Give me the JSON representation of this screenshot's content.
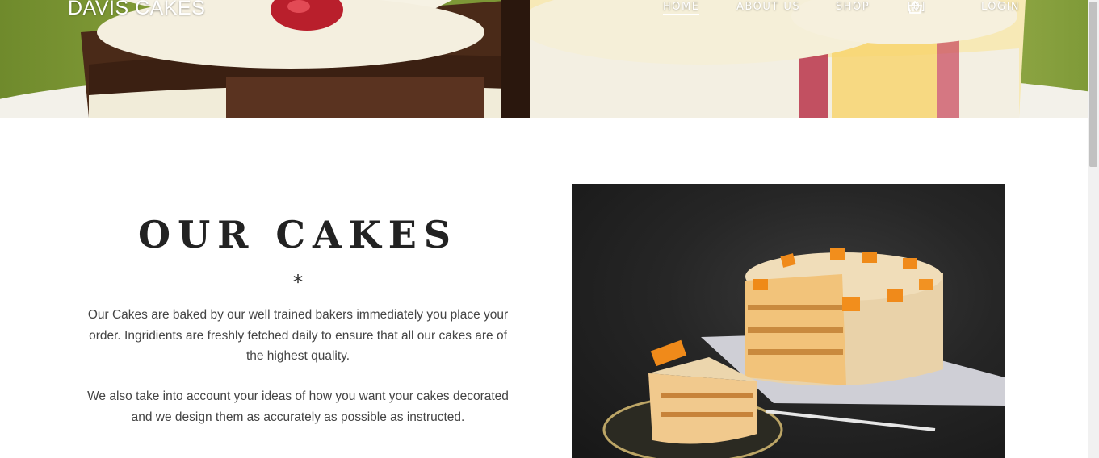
{
  "header": {
    "brand": "DAVIS CAKES",
    "nav": [
      {
        "label": "HOME",
        "active": true
      },
      {
        "label": "ABOUT US",
        "active": false
      },
      {
        "label": "SHOP",
        "active": false
      }
    ],
    "cart_count": "[0]",
    "cart_icon": "basket-icon",
    "login_label": "LOGIN"
  },
  "main": {
    "title": "OUR CAKES",
    "divider_glyph": "*",
    "paragraphs": [
      "Our Cakes are baked by our well trained bakers immediately you place your order. Ingridients are freshly fetched daily to ensure that all our cakes are of the highest quality.",
      "We also take into account your ideas of how you want your cakes decorated and we design them as accurately as possible as instructed."
    ]
  },
  "colors": {
    "text_dark": "#222222",
    "text_body": "#444444",
    "nav_text": "#ffffff"
  }
}
